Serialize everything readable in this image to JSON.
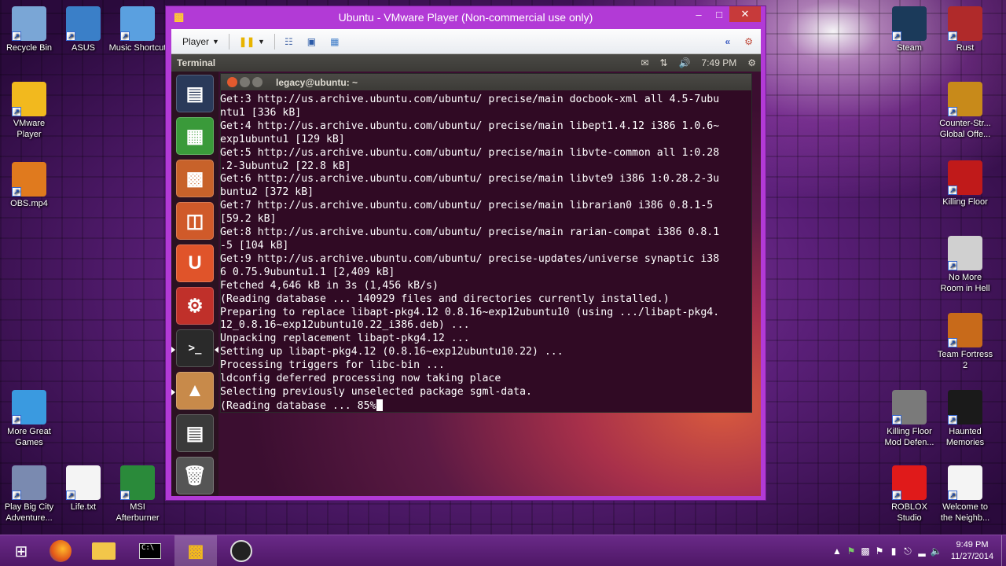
{
  "desktop": {
    "left_icons": [
      {
        "label": "Recycle Bin",
        "icon": "recycle-bin-icon",
        "color": "#7aa6d6"
      },
      {
        "label": "ASUS",
        "icon": "asus-icon",
        "color": "#3a7fc8"
      },
      {
        "label": "Music Shortcut",
        "icon": "music-folder-icon",
        "color": "#5aa0e0"
      },
      {
        "label": "VMware Player",
        "icon": "vmware-icon",
        "color": "#f2b91e"
      },
      {
        "label": "OBS.mp4",
        "icon": "video-file-icon",
        "color": "#e07a1e"
      },
      {
        "label": "More Great Games",
        "icon": "games-icon",
        "color": "#3a9ae0"
      },
      {
        "label": "Play Big City Adventure...",
        "icon": "koala-game-icon",
        "color": "#7a8ab0"
      },
      {
        "label": "Life.txt",
        "icon": "text-file-icon",
        "color": "#f4f4f4"
      },
      {
        "label": "MSI Afterburner",
        "icon": "afterburner-icon",
        "color": "#2a8a3a"
      }
    ],
    "right_icons": [
      {
        "label": "Steam",
        "icon": "steam-icon",
        "color": "#1b3a5a"
      },
      {
        "label": "Rust",
        "icon": "rust-icon",
        "color": "#b02a2a"
      },
      {
        "label": "Counter-Str... Global Offe...",
        "icon": "csgo-icon",
        "color": "#c88a1a"
      },
      {
        "label": "Killing Floor",
        "icon": "killing-floor-icon",
        "color": "#c01a1a"
      },
      {
        "label": "No More Room in Hell",
        "icon": "nmrih-icon",
        "color": "#d0d0d0"
      },
      {
        "label": "Team Fortress 2",
        "icon": "tf2-icon",
        "color": "#c86a1a"
      },
      {
        "label": "Killing Floor Mod Defen...",
        "icon": "kf-mod-icon",
        "color": "#7a7a7a"
      },
      {
        "label": "Haunted Memories",
        "icon": "haunted-memories-icon",
        "color": "#1a1a1a"
      },
      {
        "label": "ROBLOX Studio",
        "icon": "roblox-icon",
        "color": "#e01a1a"
      },
      {
        "label": "Welcome to the Neighb...",
        "icon": "document-icon",
        "color": "#f4f4f4"
      }
    ]
  },
  "vmware": {
    "title": "Ubuntu - VMware Player (Non-commercial use only)",
    "player_menu": "Player",
    "min": "–",
    "max": "□",
    "close": "✕"
  },
  "ubuntu": {
    "panel_title": "Terminal",
    "time": "7:49 PM",
    "terminal_title": "legacy@ubuntu: ~",
    "terminal_lines": [
      "Get:3 http://us.archive.ubuntu.com/ubuntu/ precise/main docbook-xml all 4.5-7ubu",
      "ntu1 [336 kB]",
      "Get:4 http://us.archive.ubuntu.com/ubuntu/ precise/main libept1.4.12 i386 1.0.6~",
      "exp1ubuntu1 [129 kB]",
      "Get:5 http://us.archive.ubuntu.com/ubuntu/ precise/main libvte-common all 1:0.28",
      ".2-3ubuntu2 [22.8 kB]",
      "Get:6 http://us.archive.ubuntu.com/ubuntu/ precise/main libvte9 i386 1:0.28.2-3u",
      "buntu2 [372 kB]",
      "Get:7 http://us.archive.ubuntu.com/ubuntu/ precise/main librarian0 i386 0.8.1-5",
      "[59.2 kB]",
      "Get:8 http://us.archive.ubuntu.com/ubuntu/ precise/main rarian-compat i386 0.8.1",
      "-5 [104 kB]",
      "Get:9 http://us.archive.ubuntu.com/ubuntu/ precise-updates/universe synaptic i38",
      "6 0.75.9ubuntu1.1 [2,409 kB]",
      "Fetched 4,646 kB in 3s (1,456 kB/s)",
      "(Reading database ... 140929 files and directories currently installed.)",
      "Preparing to replace libapt-pkg4.12 0.8.16~exp12ubuntu10 (using .../libapt-pkg4.",
      "12_0.8.16~exp12ubuntu10.22_i386.deb) ...",
      "Unpacking replacement libapt-pkg4.12 ...",
      "Setting up libapt-pkg4.12 (0.8.16~exp12ubuntu10.22) ...",
      "Processing triggers for libc-bin ...",
      "ldconfig deferred processing now taking place",
      "Selecting previously unselected package sgml-data.",
      "(Reading database ... 85%"
    ]
  },
  "taskbar": {
    "time": "9:49 PM",
    "date": "11/27/2014"
  }
}
